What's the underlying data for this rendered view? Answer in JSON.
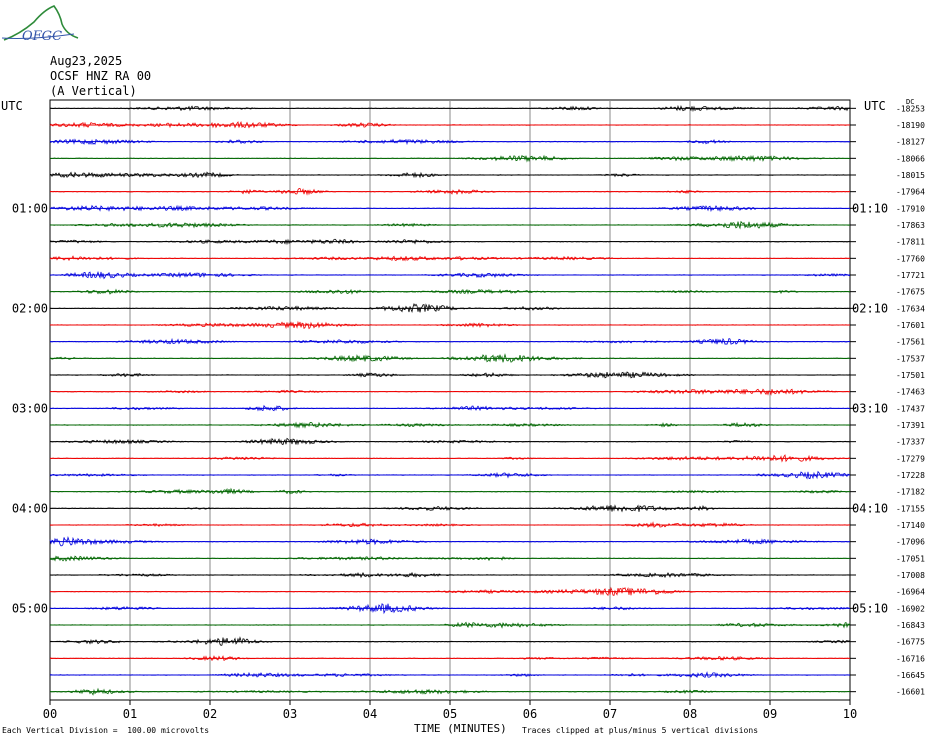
{
  "header": {
    "logo_text": "OFGC",
    "date": "Aug23,2025",
    "station": "OCSF HNZ RA 00",
    "component": "(A Vertical)",
    "utc_left": "UTC",
    "utc_right": "UTC",
    "dc_label": "DC"
  },
  "footer": {
    "scale_note": "Each Vertical Division =  100.00 microvolts",
    "axis_title": "TIME (MINUTES)",
    "clip_note": "Traces clipped at plus/minus 5 vertical divisions"
  },
  "colors": {
    "black": "#000000",
    "red": "#ee0000",
    "blue": "#0000dd",
    "green": "#006600",
    "grid": "#888888"
  },
  "chart_data": {
    "type": "line",
    "subtype": "helicorder",
    "xlabel": "TIME (MINUTES)",
    "xlim": [
      0,
      10
    ],
    "x_ticks": [
      "00",
      "01",
      "02",
      "03",
      "04",
      "05",
      "06",
      "07",
      "08",
      "09",
      "10"
    ],
    "trace_colors": [
      "black",
      "red",
      "blue",
      "green"
    ],
    "left_time_labels": [
      {
        "label": "01:00",
        "row": 6
      },
      {
        "label": "02:00",
        "row": 12
      },
      {
        "label": "03:00",
        "row": 18
      },
      {
        "label": "04:00",
        "row": 24
      },
      {
        "label": "05:00",
        "row": 30
      }
    ],
    "right_time_labels": [
      {
        "label": "01:10",
        "row": 6
      },
      {
        "label": "02:10",
        "row": 12
      },
      {
        "label": "03:10",
        "row": 18
      },
      {
        "label": "04:10",
        "row": 24
      },
      {
        "label": "05:10",
        "row": 30
      }
    ],
    "dc_offsets": [
      "-18253",
      "-18190",
      "-18127",
      "-18066",
      "-18015",
      "-17964",
      "-17910",
      "-17863",
      "-17811",
      "-17760",
      "-17721",
      "-17675",
      "-17634",
      "-17601",
      "-17561",
      "-17537",
      "-17501",
      "-17463",
      "-17437",
      "-17391",
      "-17337",
      "-17279",
      "-17228",
      "-17182",
      "-17155",
      "-17140",
      "-17096",
      "-17051",
      "-17008",
      "-16964",
      "-16902",
      "-16843",
      "-16775",
      "-16716",
      "-16645",
      "-16601"
    ],
    "grid": true
  }
}
